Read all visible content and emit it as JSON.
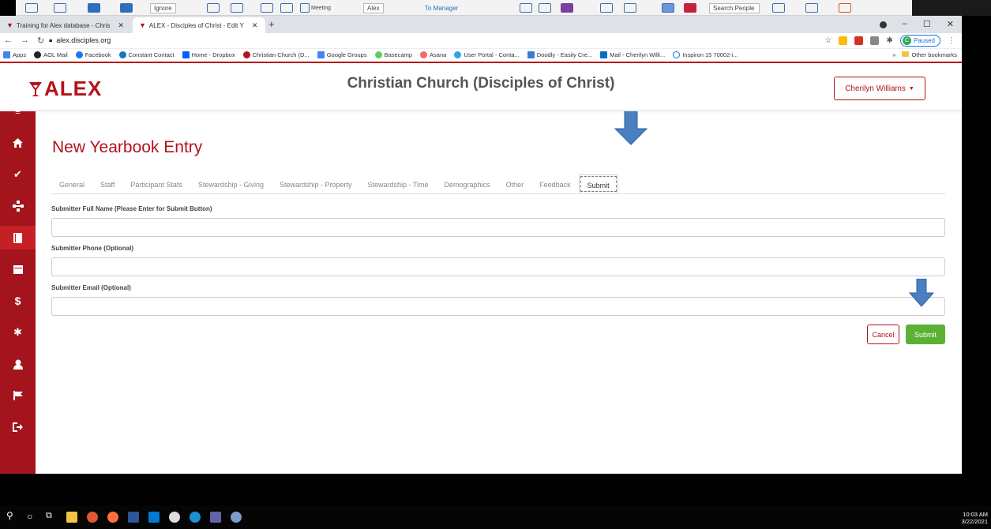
{
  "ribbon": {
    "ignore_label": "Ignore",
    "meeting_label": "Meeting",
    "alex_label": "Alex",
    "to_manager_label": "To Manager",
    "search_people": "Search People"
  },
  "browser": {
    "tabs": [
      {
        "label": "Training for Alex database - Chris"
      },
      {
        "label": "ALEX - Disciples of Christ - Edit Y"
      }
    ],
    "url": "alex.disciples.org",
    "profile_status": "Paused",
    "profile_initial": "C",
    "bookmarks": [
      {
        "label": "Apps"
      },
      {
        "label": "AOL Mail"
      },
      {
        "label": "Facebook"
      },
      {
        "label": "Constant Contact"
      },
      {
        "label": "Home - Dropbox"
      },
      {
        "label": "Christian Church (D..."
      },
      {
        "label": "Google Groups"
      },
      {
        "label": "Basecamp"
      },
      {
        "label": "Asana"
      },
      {
        "label": "User Portal - Conta..."
      },
      {
        "label": "Doodly - Easily Cre..."
      },
      {
        "label": "Mail - Cherilyn Willi..."
      },
      {
        "label": "Inspiron 15 70002-i..."
      }
    ],
    "more_bookmarks": "»",
    "other_bookmarks": "Other bookmarks"
  },
  "app": {
    "logo": "ALEX",
    "org_title": "Christian Church (Disciples of Christ)",
    "user_name": "Cherilyn Williams",
    "page_title": "New Yearbook Entry",
    "tabs": [
      {
        "label": "General"
      },
      {
        "label": "Staff"
      },
      {
        "label": "Participant Stats"
      },
      {
        "label": "Stewardship - Giving"
      },
      {
        "label": "Stewardship - Property"
      },
      {
        "label": "Stewardship - Time"
      },
      {
        "label": "Demographics"
      },
      {
        "label": "Other"
      },
      {
        "label": "Feedback"
      },
      {
        "label": "Submit"
      }
    ],
    "fields": {
      "full_name_label": "Submitter Full Name (Please Enter for Submit Button)",
      "full_name_value": "",
      "phone_label": "Submitter Phone (Optional)",
      "phone_value": "",
      "email_label": "Submitter Email (Optional)",
      "email_value": ""
    },
    "cancel_label": "Cancel",
    "submit_label": "Submit"
  },
  "taskbar": {
    "time": "10:03 AM",
    "date": "3/22/2021"
  },
  "colors": {
    "brand_red": "#b5121b",
    "sidebar_red": "#a3141c",
    "submit_green": "#5cb135",
    "arrow_blue": "#4a7fc1"
  }
}
